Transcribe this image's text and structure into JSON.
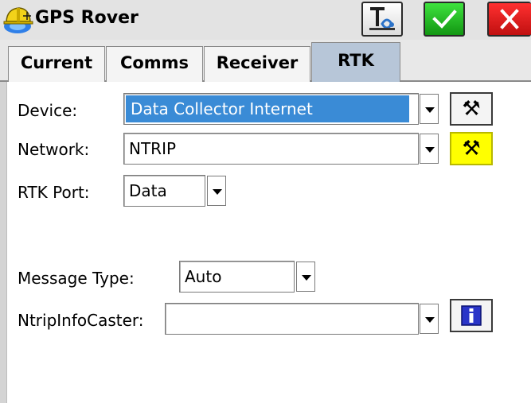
{
  "window": {
    "title": "GPS Rover",
    "icons": {
      "app": "hardhat-satellite-icon",
      "link": "link-settings-icon",
      "ok": "checkmark-icon",
      "cancel": "close-icon"
    },
    "colors": {
      "ok_green": "#1fbf1f",
      "cancel_red": "#e51c1c",
      "active_tab": "#b7c6d8",
      "device_highlight": "#3a8bd6",
      "network_tool_highlight": "#ffff00"
    }
  },
  "tabs": [
    {
      "label": "Current",
      "active": false
    },
    {
      "label": "Comms",
      "active": false
    },
    {
      "label": "Receiver",
      "active": false
    },
    {
      "label": "RTK",
      "active": true
    }
  ],
  "form": {
    "device": {
      "label": "Device:",
      "value": "Data Collector Internet"
    },
    "network": {
      "label": "Network:",
      "value": "NTRIP"
    },
    "rtk_port": {
      "label": "RTK Port:",
      "value": "Data"
    },
    "message_type": {
      "label": "Message Type:",
      "value": "Auto"
    },
    "ntrip_info_caster": {
      "label": "NtripInfoCaster:",
      "value": ""
    },
    "tool_icon": "hammer-wrench-icon",
    "info_icon": "info-icon"
  }
}
